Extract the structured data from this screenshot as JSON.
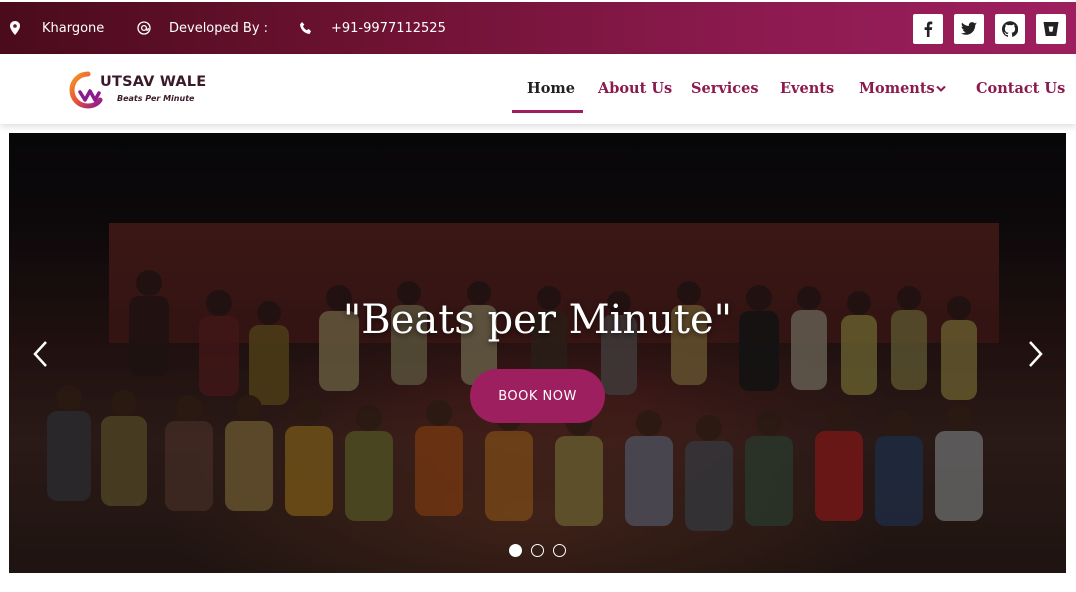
{
  "topbar": {
    "location": "Khargone",
    "developer_label": "Developed By :",
    "phone": "+91-9977112525",
    "icons": [
      "map-pin-icon",
      "at-icon",
      "phone-icon"
    ],
    "social": [
      "facebook-icon",
      "twitter-icon",
      "github-icon",
      "bitbucket-icon"
    ]
  },
  "logo": {
    "title": "UTSAV WALE",
    "subtitle": "Beats Per Minute"
  },
  "nav": {
    "items": [
      {
        "label": "Home",
        "active": true
      },
      {
        "label": "About Us"
      },
      {
        "label": "Services"
      },
      {
        "label": "Events"
      },
      {
        "label": "Moments",
        "dropdown": true
      },
      {
        "label": "Contact Us"
      }
    ]
  },
  "hero": {
    "title": "\"Beats per Minute\"",
    "button": "BOOK NOW",
    "slides": 3,
    "active_slide": 1
  },
  "colors": {
    "accent": "#9e1f5f",
    "topbar_dark": "#4a0b1c"
  }
}
